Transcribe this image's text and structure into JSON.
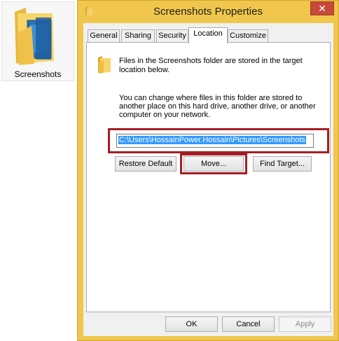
{
  "desktop": {
    "folder_label": "Screenshots"
  },
  "dialog": {
    "title": "Screenshots Properties",
    "close_label": "✕",
    "tabs": [
      {
        "label": "General"
      },
      {
        "label": "Sharing"
      },
      {
        "label": "Security"
      },
      {
        "label": "Location"
      },
      {
        "label": "Customize"
      }
    ],
    "active_tab": "Location",
    "location": {
      "info_text": "Files in the Screenshots folder are stored in the target location below.",
      "description": "You can change where files in this folder are stored to another place on this hard drive, another drive, or another computer on your network.",
      "path_value": "C:\\Users\\HossainPower.Hossain\\Pictures\\Screenshots",
      "restore_default_label": "Restore Default",
      "move_label": "Move...",
      "find_target_label": "Find Target..."
    },
    "footer": {
      "ok_label": "OK",
      "cancel_label": "Cancel",
      "apply_label": "Apply"
    }
  },
  "colors": {
    "window_frame": "#f0c74c",
    "close_button": "#c7493a",
    "highlight_box": "#a31e24",
    "selection": "#3399ff"
  }
}
